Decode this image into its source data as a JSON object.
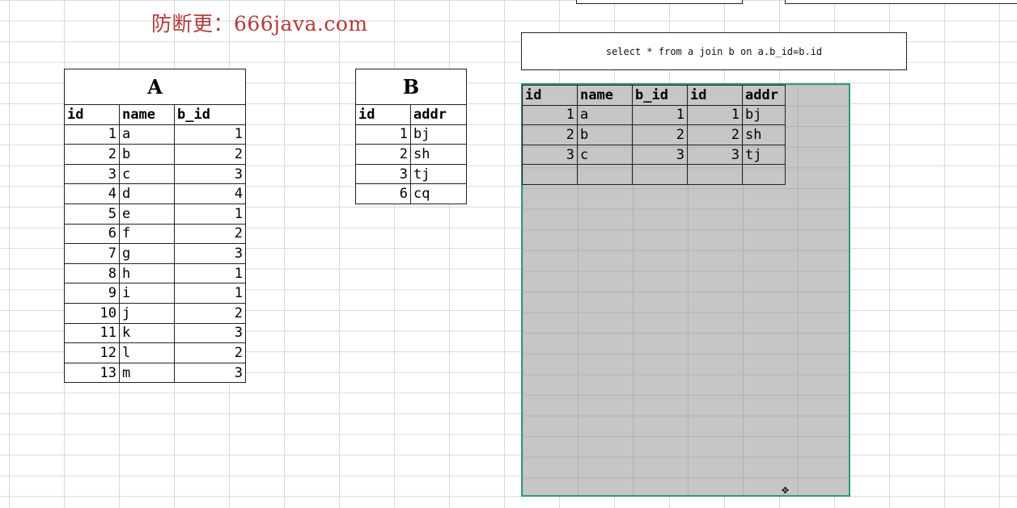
{
  "watermark": "防断更：666java.com",
  "table_a": {
    "title": "A",
    "headers": [
      "id",
      "name",
      "b_id"
    ],
    "rows": [
      [
        "1",
        "a",
        "1"
      ],
      [
        "2",
        "b",
        "2"
      ],
      [
        "3",
        "c",
        "3"
      ],
      [
        "4",
        "d",
        "4"
      ],
      [
        "5",
        "e",
        "1"
      ],
      [
        "6",
        "f",
        "2"
      ],
      [
        "7",
        "g",
        "3"
      ],
      [
        "8",
        "h",
        "1"
      ],
      [
        "9",
        "i",
        "1"
      ],
      [
        "10",
        "j",
        "2"
      ],
      [
        "11",
        "k",
        "3"
      ],
      [
        "12",
        "l",
        "2"
      ],
      [
        "13",
        "m",
        "3"
      ]
    ]
  },
  "table_b": {
    "title": "B",
    "headers": [
      "id",
      "addr"
    ],
    "rows": [
      [
        "1",
        "bj"
      ],
      [
        "2",
        "sh"
      ],
      [
        "3",
        "tj"
      ],
      [
        "6",
        "cq"
      ]
    ]
  },
  "query": {
    "sql": "select * from a join b on a.b_id=b.id"
  },
  "result": {
    "headers": [
      "id",
      "name",
      "b_id",
      "id",
      "addr"
    ],
    "rows": [
      [
        "1",
        "a",
        "1",
        "1",
        "bj"
      ],
      [
        "2",
        "b",
        "2",
        "2",
        "sh"
      ],
      [
        "3",
        "c",
        "3",
        "3",
        "tj"
      ]
    ]
  },
  "colors": {
    "selection_border": "#2e9e7a",
    "selection_fill": "#c6c6c6",
    "watermark": "#b23a3a"
  },
  "icons": {
    "cursor": "move-cursor-icon"
  }
}
